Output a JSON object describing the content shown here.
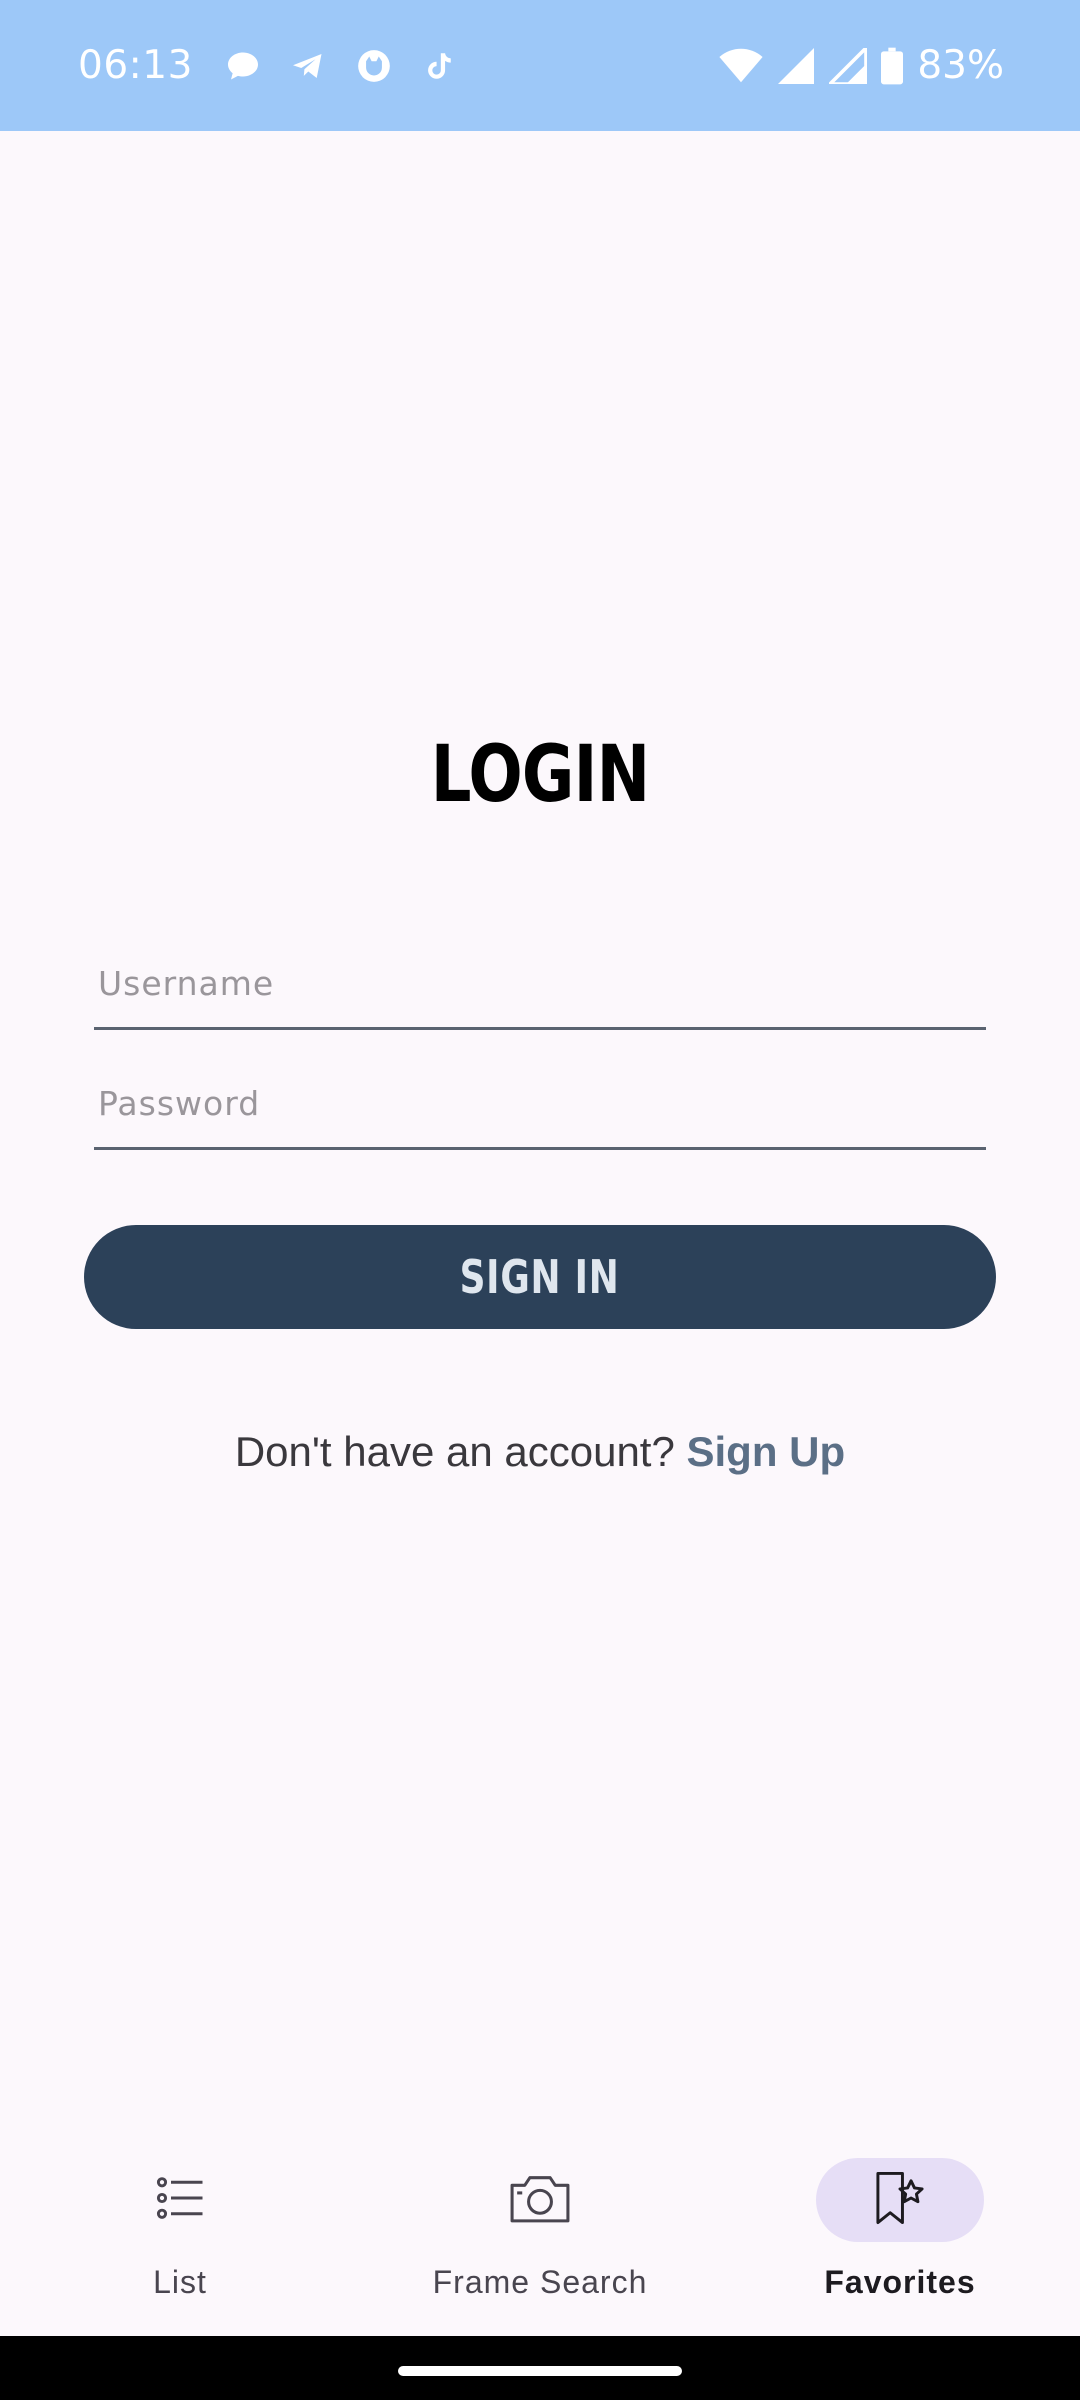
{
  "status_bar": {
    "time": "06:13",
    "battery": "83%",
    "notification_icons": [
      "chat-bubble-icon",
      "telegram-icon",
      "cat-app-icon",
      "tiktok-icon"
    ],
    "system_icons": [
      "wifi-icon",
      "signal-icon",
      "signal-icon",
      "battery-icon"
    ],
    "background_color": "#9dc8f8"
  },
  "login": {
    "title": "LOGIN",
    "username_placeholder": "Username",
    "password_placeholder": "Password",
    "sign_in_label": "SIGN IN",
    "no_account_text": "Don't have an account?",
    "sign_up_label": "Sign Up"
  },
  "bottom_nav": {
    "items": [
      {
        "label": "List",
        "icon": "list-icon",
        "active": false
      },
      {
        "label": "Frame Search",
        "icon": "camera-icon",
        "active": false
      },
      {
        "label": "Favorites",
        "icon": "bookmark-star-icon",
        "active": true
      }
    ]
  },
  "colors": {
    "primary": "#2c4159",
    "link": "#5b6f86",
    "active_nav": "#e6def6"
  }
}
